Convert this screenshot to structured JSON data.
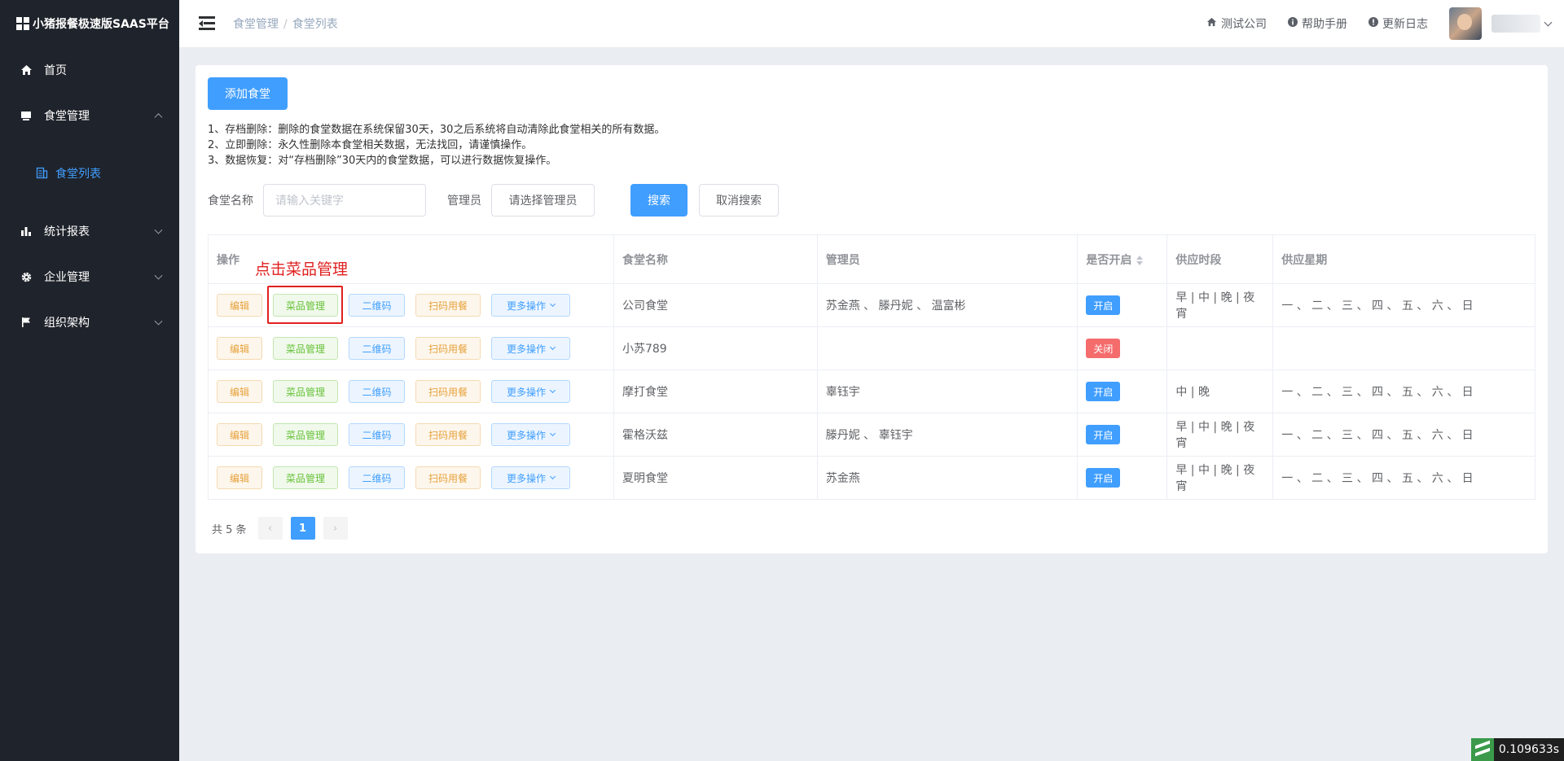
{
  "sidebar": {
    "title": "小猪报餐极速版SAAS平台",
    "items": [
      {
        "label": "首页",
        "icon": "home-icon"
      },
      {
        "label": "食堂管理",
        "icon": "canteen-icon",
        "expanded": true
      },
      {
        "label": "统计报表",
        "icon": "bar-chart-icon"
      },
      {
        "label": "企业管理",
        "icon": "gear-icon"
      },
      {
        "label": "组织架构",
        "icon": "flag-icon"
      }
    ],
    "sub_items": [
      {
        "label": "食堂列表",
        "icon": "list-icon"
      }
    ]
  },
  "header": {
    "breadcrumb": [
      "食堂管理",
      "食堂列表"
    ],
    "links": [
      {
        "label": "测试公司",
        "icon": "home-icon"
      },
      {
        "label": "帮助手册",
        "icon": "info-icon"
      },
      {
        "label": "更新日志",
        "icon": "info-icon"
      }
    ]
  },
  "main": {
    "add_button": "添加食堂",
    "notes": [
      "1、存档删除：删除的食堂数据在系统保留30天，30之后系统将自动清除此食堂相关的所有数据。",
      "2、立即删除：永久性删除本食堂相关数据，无法找回，请谨慎操作。",
      "3、数据恢复：对“存档删除”30天内的食堂数据，可以进行数据恢复操作。"
    ],
    "search": {
      "name_label": "食堂名称",
      "name_placeholder": "请输入关键字",
      "admin_label": "管理员",
      "admin_select": "请选择管理员",
      "search_button": "搜索",
      "cancel_button": "取消搜索"
    },
    "table": {
      "headers": [
        "操作",
        "食堂名称",
        "管理员",
        "是否开启",
        "供应时段",
        "供应星期"
      ],
      "op_labels": {
        "edit": "编辑",
        "dish": "菜品管理",
        "qr": "二维码",
        "scan": "扫码用餐",
        "more": "更多操作"
      },
      "rows": [
        {
          "name": "公司食堂",
          "admins": "苏金燕 、 滕丹妮 、 温富彬",
          "status": "开启",
          "on": true,
          "periods": "早 | 中 | 晚 | 夜宵",
          "weekdays": "一 、 二 、 三 、 四 、 五 、 六 、 日"
        },
        {
          "name": "小苏789",
          "admins": "",
          "status": "关闭",
          "on": false,
          "periods": "",
          "weekdays": ""
        },
        {
          "name": "摩打食堂",
          "admins": "辜钰宇",
          "status": "开启",
          "on": true,
          "periods": "中 | 晚",
          "weekdays": "一 、 二 、 三 、 四 、 五 、 六 、 日"
        },
        {
          "name": "霍格沃兹",
          "admins": "滕丹妮 、 辜钰宇",
          "status": "开启",
          "on": true,
          "periods": "早 | 中 | 晚 | 夜宵",
          "weekdays": "一 、 二 、 三 、 四 、 五 、 六 、 日"
        },
        {
          "name": "夏明食堂",
          "admins": "苏金燕",
          "status": "开启",
          "on": true,
          "periods": "早 | 中 | 晚 | 夜宵",
          "weekdays": "一 、 二 、 三 、 四 、 五 、 六 、 日"
        }
      ]
    },
    "annotation": "点击菜品管理",
    "pagination": {
      "total": "共 5 条",
      "current": "1",
      "prev": "‹",
      "next": "›"
    }
  },
  "timer": "0.109633s",
  "colors": {
    "primary": "#409eff",
    "sidebar_bg": "#1f232b",
    "danger": "#f56c6c",
    "success": "#67c23a",
    "warning": "#e6a23c",
    "annotation": "#e02020"
  }
}
